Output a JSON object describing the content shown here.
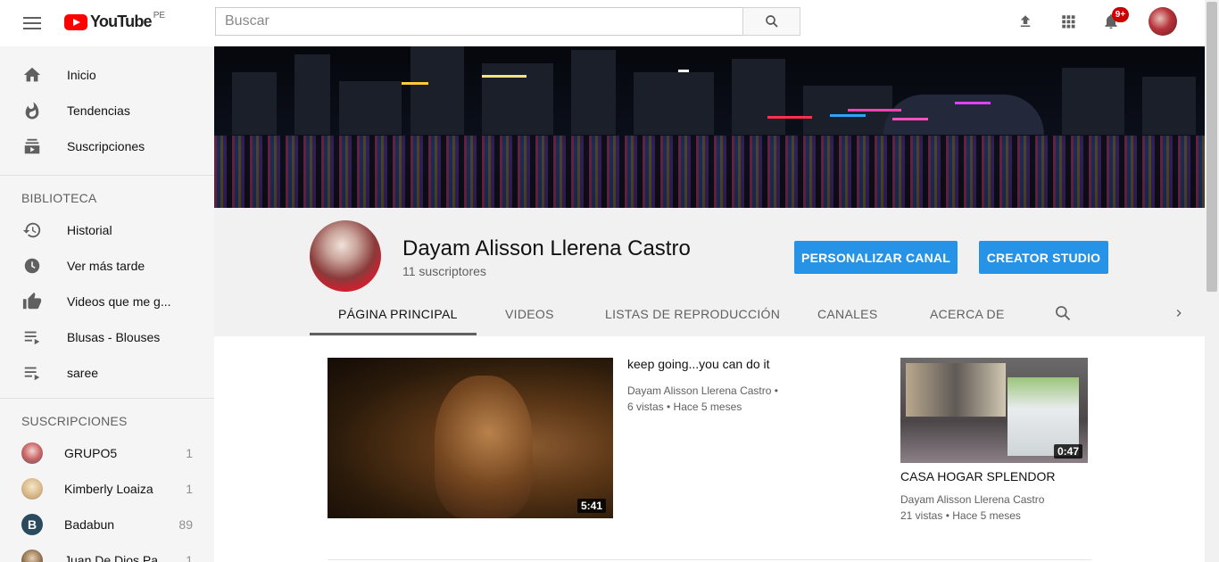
{
  "header": {
    "brand": "YouTube",
    "country": "PE",
    "search_placeholder": "Buscar",
    "notifications_badge": "9+"
  },
  "sidebar": {
    "main_items": [
      {
        "label": "Inicio",
        "icon": "home-icon"
      },
      {
        "label": "Tendencias",
        "icon": "trending-icon"
      },
      {
        "label": "Suscripciones",
        "icon": "subscriptions-icon"
      }
    ],
    "library_title": "BIBLIOTECA",
    "library_items": [
      {
        "label": "Historial",
        "icon": "history-icon"
      },
      {
        "label": "Ver más tarde",
        "icon": "watch-later-icon"
      },
      {
        "label": "Videos que me g...",
        "icon": "thumb-up-icon"
      },
      {
        "label": "Blusas - Blouses",
        "icon": "playlist-icon"
      },
      {
        "label": "saree",
        "icon": "playlist-icon"
      }
    ],
    "subs_title": "SUSCRIPCIONES",
    "subs": [
      {
        "label": "GRUPO5",
        "count": "1"
      },
      {
        "label": "Kimberly Loaiza",
        "count": "1"
      },
      {
        "label": "Badabun",
        "count": "89",
        "initial": "B"
      },
      {
        "label": "Juan De Dios Pa...",
        "count": "1"
      }
    ]
  },
  "channel": {
    "name": "Dayam Alisson Llerena Castro",
    "subscribers": "11 suscriptores",
    "customize_button": "PERSONALIZAR CANAL",
    "studio_button": "CREATOR STUDIO",
    "tabs": [
      "PÁGINA PRINCIPAL",
      "VIDEOS",
      "LISTAS DE REPRODUCCIÓN",
      "CANALES",
      "ACERCA DE"
    ],
    "active_tab": "PÁGINA PRINCIPAL"
  },
  "featured_video": {
    "title": "keep going...you can do it",
    "channel": "Dayam Alisson Llerena Castro",
    "meta": "6 vistas • Hace 5 meses",
    "duration": "5:41"
  },
  "side_video": {
    "title": "CASA HOGAR SPLENDOR",
    "channel": "Dayam Alisson Llerena Castro",
    "meta": "21 vistas • Hace 5 meses",
    "duration": "0:47"
  },
  "colors": {
    "accent_blue": "#2793e6",
    "brand_red": "#ff0000",
    "badge_red": "#cc0000"
  }
}
